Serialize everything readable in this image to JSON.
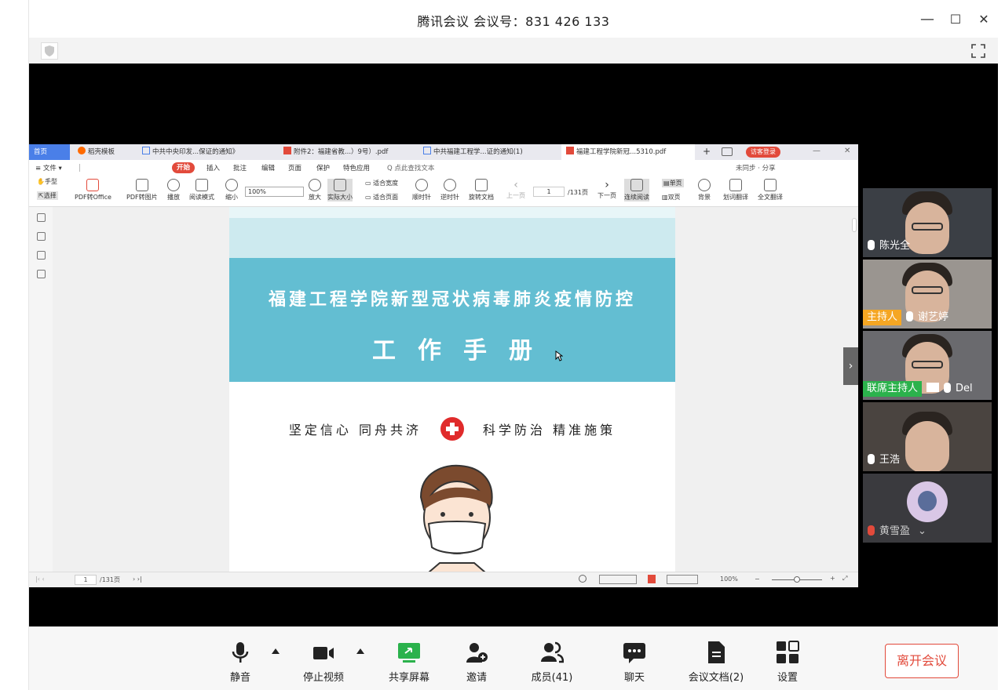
{
  "window": {
    "title": "腾讯会议 会议号：831 426 133",
    "minimize": "—",
    "maximize": "☐",
    "close": "✕"
  },
  "pdf": {
    "tabs": [
      {
        "label": "首页"
      },
      {
        "label": "稻壳模板"
      },
      {
        "label": "中共中央印发...保证的通知》"
      },
      {
        "label": "附件2：福建省教...）9号）.pdf"
      },
      {
        "label": "中共福建工程学...证的通知(1)"
      },
      {
        "label": "福建工程学院新冠...5310.pdf"
      }
    ],
    "login_label": "访客登录",
    "menu": [
      "≡ 文件 ▾",
      "开始",
      "插入",
      "批注",
      "编辑",
      "页面",
      "保护",
      "特色应用",
      "Q 点此查找文本"
    ],
    "menu_right": "未同步 · 分享",
    "ribbon": {
      "hand": "手型",
      "select": "选择",
      "pdf_to_office": "PDF转Office",
      "pdf_to_image": "PDF转图片",
      "play": "播放",
      "read_mode": "阅读模式",
      "zoom_out": "缩小",
      "zoom_value": "100%",
      "zoom_in": "放大",
      "actual_size": "实际大小",
      "fit_width": "适合宽度",
      "fit_page": "适合页面",
      "rotate_cw": "顺时针",
      "rotate_ccw": "逆时针",
      "rotate_doc": "旋转文档",
      "prev_page": "上一页",
      "page_value": "1",
      "page_total": "/131页",
      "next_page": "下一页",
      "continuous": "连续阅读",
      "single": "单页",
      "double": "双页",
      "background": "背景",
      "word_translate": "划词翻译",
      "full_translate": "全文翻译"
    },
    "doc": {
      "title_line1": "福建工程学院新型冠状病毒肺炎疫情防控",
      "title_line2": "工作手册",
      "slogan_left": "坚定信心  同舟共济",
      "slogan_right": "科学防治  精准施策"
    },
    "status": {
      "page_value": "1",
      "page_total": "/131页",
      "zoom": "100%"
    }
  },
  "participants": [
    {
      "name": "陈光全",
      "role": ""
    },
    {
      "name": "谢艺婷",
      "role": "主持人"
    },
    {
      "name": "Del",
      "role": "联席主持人"
    },
    {
      "name": "王浩",
      "role": ""
    },
    {
      "name": "黄雪盈",
      "role": ""
    }
  ],
  "toolbar": {
    "mute": "静音",
    "stop_video": "停止视频",
    "share_screen": "共享屏幕",
    "invite": "邀请",
    "members": "成员(41)",
    "chat": "聊天",
    "docs": "会议文档(2)",
    "settings": "设置",
    "leave": "离开会议"
  },
  "colors": {
    "accent_red": "#e24a3b",
    "share_green": "#2bb24c",
    "host_orange": "#f5a623",
    "doc_teal": "#63bed2"
  }
}
